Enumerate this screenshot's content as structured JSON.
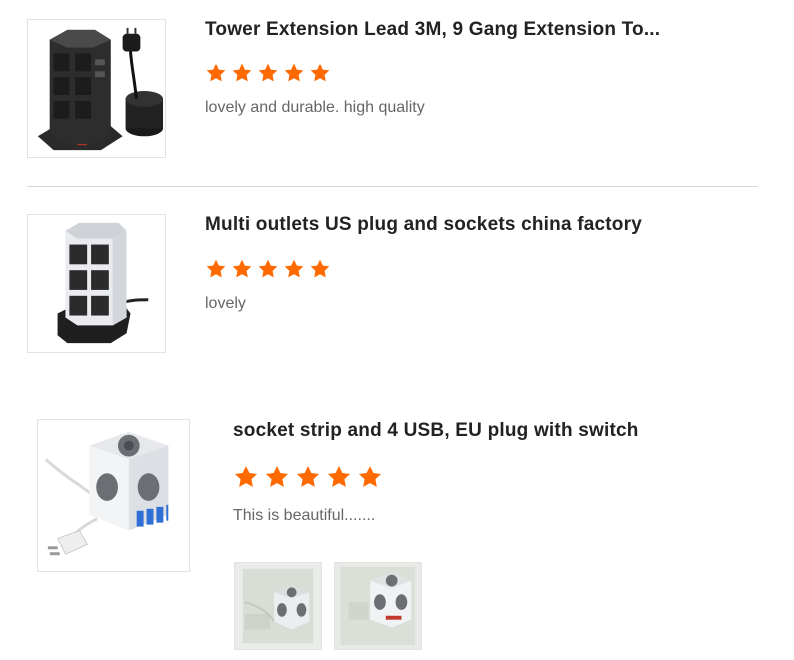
{
  "reviews": [
    {
      "product_title": "Tower Extension Lead 3M, 9 Gang Extension To...",
      "rating": 5,
      "comment": "lovely and durable. high quality",
      "image_icon": "tower-extension-lead-image"
    },
    {
      "product_title": "Multi outlets US plug and sockets china factory",
      "rating": 5,
      "comment": "lovely",
      "image_icon": "multi-outlet-tower-image"
    },
    {
      "product_title": "socket strip and 4 USB, EU plug with switch",
      "rating": 5,
      "comment": "This is beautiful.......",
      "image_icon": "cube-socket-image",
      "customer_photos": [
        "customer-photo-1",
        "customer-photo-2"
      ]
    }
  ],
  "colors": {
    "star": "#ff6a00",
    "divider": "#d8d8d8",
    "title": "#222222",
    "comment": "#666666"
  }
}
